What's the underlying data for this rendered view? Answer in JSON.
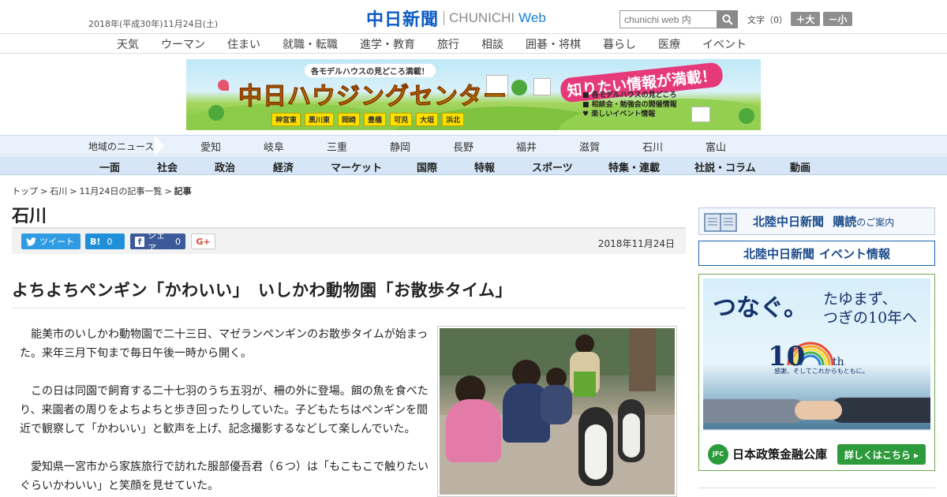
{
  "header": {
    "date": "2018年(平成30年)11月24日(土)",
    "logo_jp": "中日新聞",
    "logo_en": "CHUNICHI",
    "logo_web": "Web",
    "search_placeholder": "chunichi web 内",
    "fontsize_label": "文字（0）",
    "fontsize_large": "＋大",
    "fontsize_small": "－小"
  },
  "categories": [
    "天気",
    "ウーマン",
    "住まい",
    "就職・転職",
    "進学・教育",
    "旅行",
    "相談",
    "囲碁・将棋",
    "暮らし",
    "医療",
    "イベント"
  ],
  "banner": {
    "tag": "各モデルハウスの見どころ満載！",
    "title": "中日ハウジングセンター",
    "catch": "知りたい情報が満載！",
    "list": [
      "各モデルハウスの見どころ",
      "相談会・勉強会の開催情報",
      "楽しいイベント情報"
    ],
    "cities": [
      "神宮東",
      "黒川東",
      "岡崎",
      "豊橋",
      "可児",
      "大垣",
      "浜北"
    ]
  },
  "region_nav": {
    "label": "地域のニュース",
    "items": [
      "愛知",
      "岐阜",
      "三重",
      "静岡",
      "長野",
      "福井",
      "滋賀",
      "石川",
      "富山"
    ]
  },
  "section_nav": [
    "一面",
    "社会",
    "政治",
    "経済",
    "マーケット",
    "国際",
    "特報",
    "スポーツ",
    "特集・連載",
    "社説・コラム",
    "動画"
  ],
  "breadcrumb": [
    "トップ",
    "石川",
    "11月24日の記事一覧",
    "記事"
  ],
  "section_title": "石川",
  "share": {
    "tweet": "ツイート",
    "hatena_label": "B!",
    "hatena_count": "0",
    "fb_label": "シェア",
    "fb_count": "0",
    "gplus": "G+"
  },
  "article": {
    "date": "2018年11月24日",
    "headline": "よちよちペンギン「かわいい」　いしかわ動物園「お散歩タイム」",
    "paragraphs": [
      "能美市のいしかわ動物園で二十三日、マゼランペンギンのお散歩タイムが始まった。来年三月下旬まで毎日午後一時から開く。",
      "この日は同園で飼育する二十七羽のうち五羽が、柵の外に登場。餌の魚を食べたり、来園者の周りをよちよちと歩き回ったりしていた。子どもたちはペンギンを間近で観察して「かわいい」と歓声を上げ、記念撮影するなどして楽しんでいた。",
      "愛知県一宮市から家族旅行で訪れた服部優吾君（６つ）は「もこもこで触りたいぐらいかわいい」と笑顔を見せていた。"
    ]
  },
  "sidebar": {
    "subscribe_title": "北陸中日新聞",
    "subscribe_kodoku": "購読",
    "subscribe_suffix": "のご案内",
    "event_title": "北陸中日新聞",
    "event_suffix": "イベント情報",
    "jfc": {
      "main": "つなぐ。",
      "sub1": "たゆまず、",
      "sub2": "つぎの10年へ",
      "tenth_num": "10",
      "tenth_suffix": "th",
      "motto": "感謝、そしてこれからもともに。",
      "logo": "JFC",
      "name": "日本政策金融公庫",
      "button": "詳しくはこちら ▸"
    }
  }
}
